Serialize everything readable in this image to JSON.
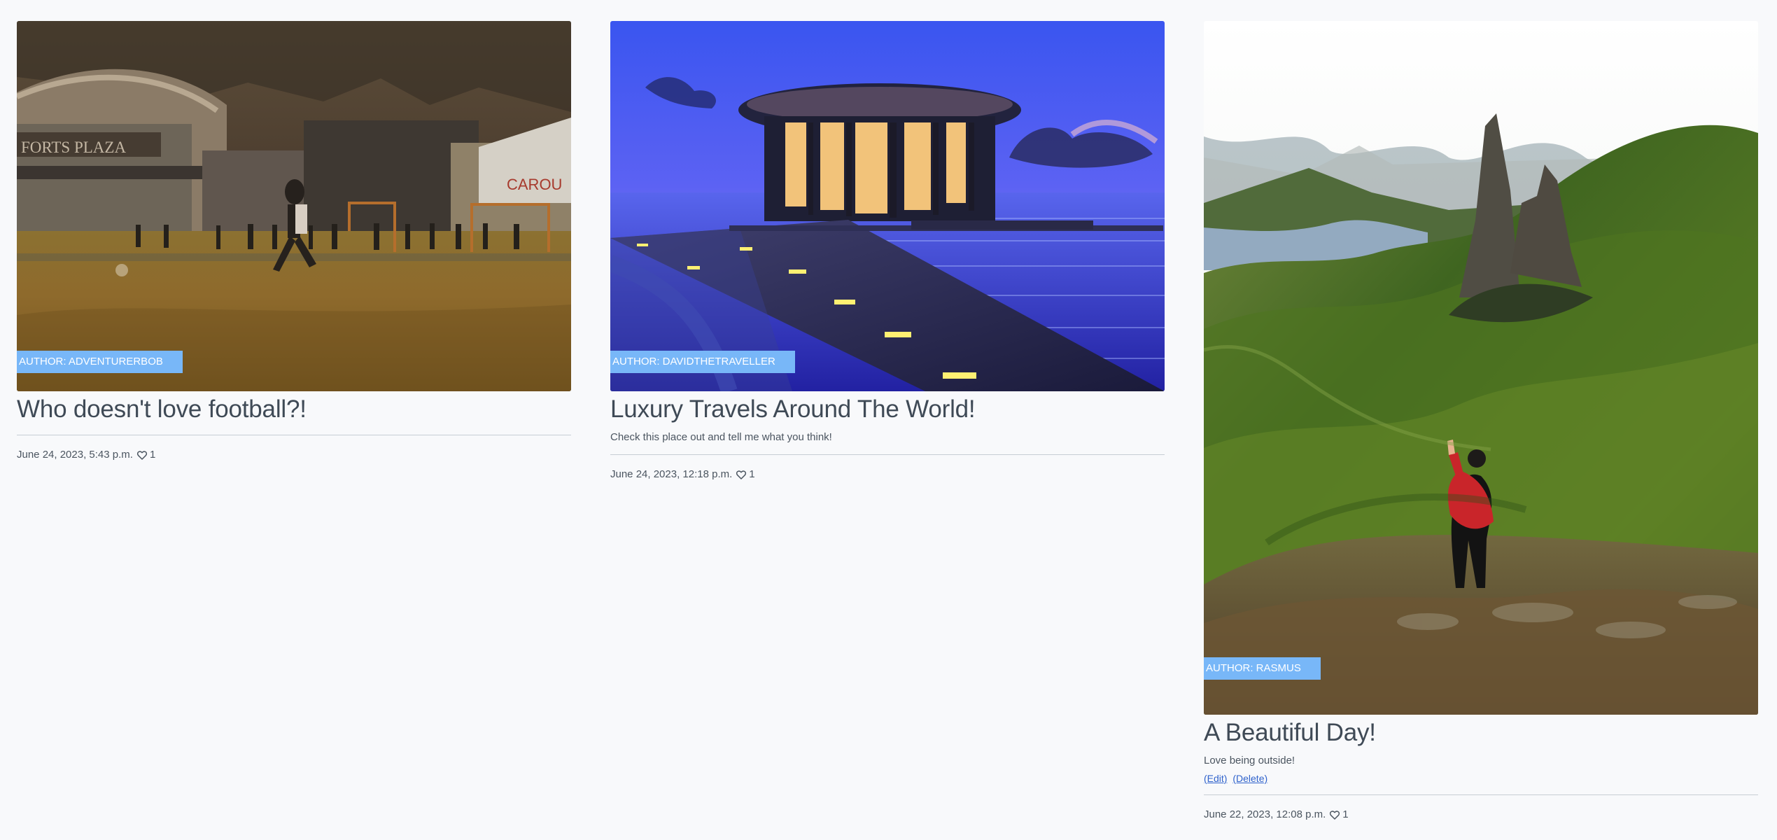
{
  "posts": [
    {
      "author_label": "AUTHOR: ADVENTURERBOB",
      "title": "Who doesn't love football?!",
      "excerpt": "",
      "date": "June 24, 2023, 5:43 p.m.",
      "likes": "1",
      "image_scene": "football-field-photo"
    },
    {
      "author_label": "AUTHOR: DAVIDTHETRAVELLER",
      "title": "Luxury Travels Around The World!",
      "excerpt": "Check this place out and tell me what you think!",
      "date": "June 24, 2023, 12:18 p.m.",
      "likes": "1",
      "image_scene": "ocean-pavilion-photo"
    },
    {
      "author_label": "AUTHOR: RASMUS",
      "title": "A Beautiful Day!",
      "excerpt": "Love being outside!",
      "edit_label": "(Edit)",
      "delete_label": "(Delete)",
      "date": "June 22, 2023, 12:08 p.m.",
      "likes": "1",
      "image_scene": "green-mountain-photo"
    }
  ],
  "colors": {
    "page_background": "#f8f9fb",
    "author_badge": "#78b7f8",
    "text": "#3f4a56",
    "link": "#2f62cc"
  },
  "icons": {
    "like": "heart-icon"
  }
}
